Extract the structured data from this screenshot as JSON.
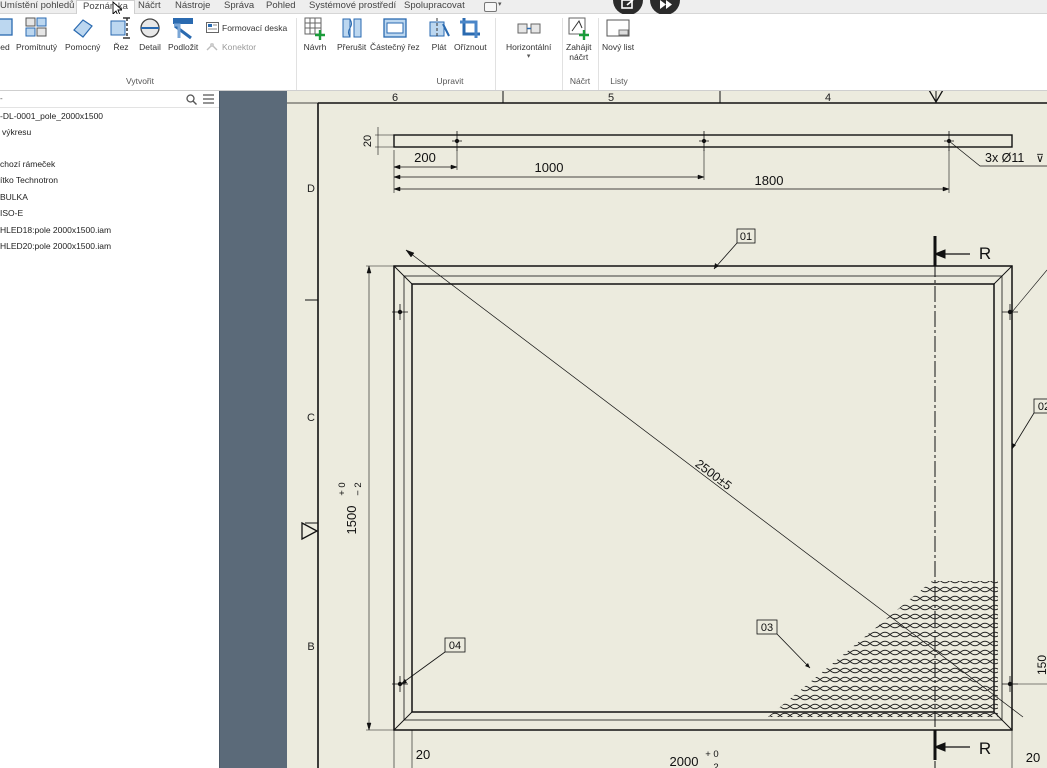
{
  "tabs": [
    {
      "label": "Umístění pohledů",
      "active": false
    },
    {
      "label": "Poznámka",
      "active": true
    },
    {
      "label": "Náčrt",
      "active": false
    },
    {
      "label": "Nástroje",
      "active": false
    },
    {
      "label": "Správa",
      "active": false
    },
    {
      "label": "Pohled",
      "active": false
    },
    {
      "label": "Systémové prostředí",
      "active": false
    },
    {
      "label": "Spolupracovat",
      "active": false
    }
  ],
  "ribbon": {
    "create": {
      "title": "Vytvořit",
      "buttons": [
        "led",
        "Promítnutý",
        "Pomocný",
        "Řez",
        "Detail",
        "Podložit"
      ],
      "small": [
        "Formovací deska",
        "Konektor"
      ]
    },
    "modify": {
      "title": "Upravit",
      "buttons": [
        "Návrh",
        "Přerušit",
        "Částečný řez",
        "Plát",
        "Oříznout",
        "Horizontální"
      ]
    },
    "sketch": {
      "title": "Náčrt",
      "buttons": [
        "Zahájit",
        "náčrt"
      ]
    },
    "sheets": {
      "title": "Listy",
      "buttons": [
        "Nový list"
      ]
    }
  },
  "browser": {
    "items": [
      "-DL-0001_pole_2000x1500",
      "výkresu",
      "chozí rámeček",
      "ítko Technotron",
      "BULKA",
      "ISO-E",
      "HLED18:pole 2000x1500.iam",
      "HLED20:pole 2000x1500.iam"
    ]
  },
  "drawing": {
    "zone_top": [
      "6",
      "5",
      "4"
    ],
    "zone_left": [
      "D",
      "C",
      "B"
    ],
    "dims": {
      "thickness": "20",
      "d200": "200",
      "d1000": "1000",
      "d1800": "1800",
      "holes": "3x Ø11",
      "diagonal": "2500±5",
      "height_main": "1500",
      "height_tol_upper": "+ 0",
      "height_tol_lower": "− 2",
      "height_right": "150",
      "width_main": "2000",
      "width_tol_upper": "+ 0",
      "width_tol_lower": "2",
      "bottom_left": "20",
      "bottom_right": "20"
    },
    "section": "R",
    "balloons": [
      "01",
      "02",
      "03",
      "04"
    ]
  }
}
